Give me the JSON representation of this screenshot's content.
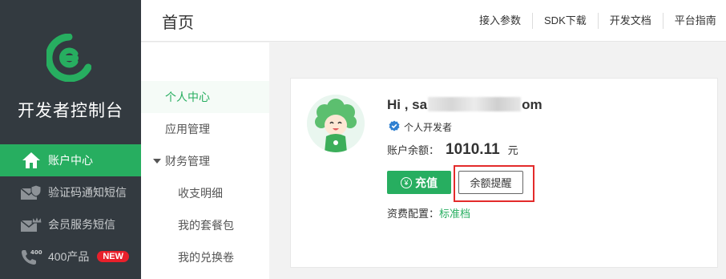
{
  "brand": {
    "name": "开发者控制台",
    "accent_color": "#27ae60"
  },
  "sidebar": {
    "items": [
      {
        "label": "账户中心",
        "icon": "home-icon",
        "active": true
      },
      {
        "label": "验证码通知短信",
        "icon": "envelope-shield-icon",
        "active": false
      },
      {
        "label": "会员服务短信",
        "icon": "envelope-crown-icon",
        "active": false
      },
      {
        "label": "400产品",
        "icon": "phone-400-icon",
        "active": false,
        "badge": "NEW"
      }
    ]
  },
  "header": {
    "title": "首页",
    "links": [
      "接入参数",
      "SDK下载",
      "开发文档",
      "平台指南"
    ]
  },
  "subnav": {
    "items": [
      {
        "label": "个人中心",
        "active": true
      },
      {
        "label": "应用管理"
      },
      {
        "label": "财务管理",
        "expandable": true,
        "expanded": true
      },
      {
        "label": "收支明细",
        "child": true
      },
      {
        "label": "我的套餐包",
        "child": true
      },
      {
        "label": "我的兑换卷",
        "child": true
      }
    ]
  },
  "account": {
    "greeting_prefix": "Hi , sa",
    "greeting_suffix": "om",
    "verify_label": "个人开发者",
    "balance_label": "账户余额：",
    "balance_value": "1010.11",
    "balance_unit": "元",
    "recharge_label": "充值",
    "recharge_icon": "yen-icon",
    "remind_label": "余额提醒",
    "plan_label": "资费配置：",
    "plan_value": "标准档"
  }
}
